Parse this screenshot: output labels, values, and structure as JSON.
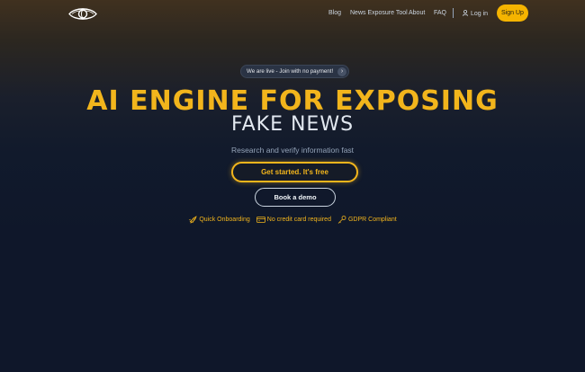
{
  "nav": {
    "links": [
      "Blog",
      "News Exposure Tool",
      "About",
      "FAQ"
    ],
    "login_label": "Log in",
    "signup_label": "Sign Up"
  },
  "announcement": {
    "text": "We are live - Join with no payment!",
    "arrow": "›"
  },
  "hero": {
    "headline": "AI ENGINE FOR EXPOSING",
    "subheadline": "FAKE NEWS",
    "tagline": "Research and verify information fast",
    "primary_cta": "Get started. It's free",
    "secondary_cta": "Book a demo"
  },
  "features": [
    {
      "icon": "rocket-icon",
      "label": "Quick Onboarding"
    },
    {
      "icon": "credit-card-icon",
      "label": "No credit card required"
    },
    {
      "icon": "key-icon",
      "label": "GDPR Compliant"
    }
  ],
  "colors": {
    "accent": "#f2b51c",
    "background": "#0f172a",
    "text": "#e2e8f0"
  },
  "icons": {
    "logo": "eye-logo-icon",
    "login": "user-icon"
  }
}
